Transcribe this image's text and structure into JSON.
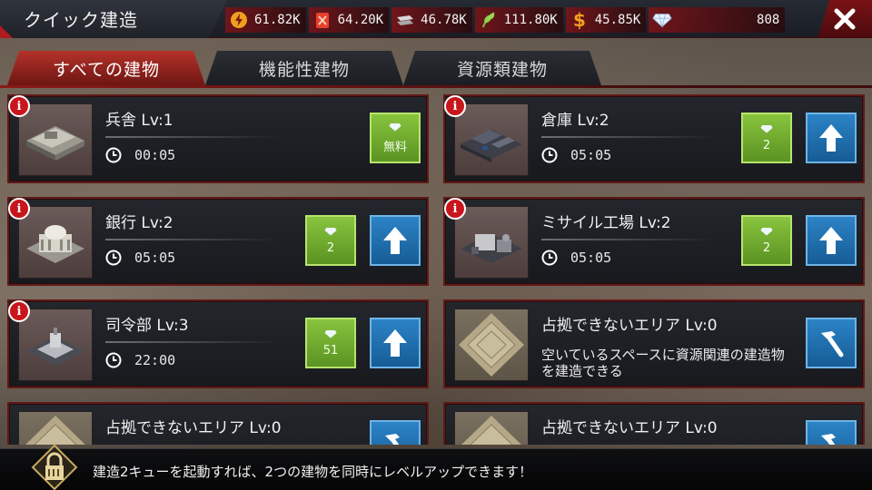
{
  "header": {
    "title": "クイック建造",
    "resources": [
      {
        "icon": "energy-icon",
        "value": "61.82K"
      },
      {
        "icon": "fuel-icon",
        "value": "64.20K"
      },
      {
        "icon": "steel-icon",
        "value": "46.78K"
      },
      {
        "icon": "food-icon",
        "value": "111.80K"
      },
      {
        "icon": "money-icon",
        "value": "45.85K"
      },
      {
        "icon": "diamond-icon",
        "value": "808"
      }
    ]
  },
  "tabs": [
    {
      "label": "すべての建物",
      "active": true
    },
    {
      "label": "機能性建物",
      "active": false
    },
    {
      "label": "資源類建物",
      "active": false
    }
  ],
  "cards": [
    {
      "name": "兵舎 Lv:1",
      "time": "00:05",
      "gem_label": "無料",
      "upgrade": false
    },
    {
      "name": "倉庫 Lv:2",
      "time": "05:05",
      "gem_label": "2",
      "upgrade": true
    },
    {
      "name": "銀行 Lv:2",
      "time": "05:05",
      "gem_label": "2",
      "upgrade": true
    },
    {
      "name": "ミサイル工場 Lv:2",
      "time": "05:05",
      "gem_label": "2",
      "upgrade": true
    },
    {
      "name": "司令部 Lv:3",
      "time": "22:00",
      "gem_label": "51",
      "upgrade": true
    },
    {
      "name": "占拠できないエリア Lv:0",
      "desc": "空いているスペースに資源関連の建造物を建造できる"
    },
    {
      "name": "占拠できないエリア Lv:0"
    },
    {
      "name": "占拠できないエリア Lv:0"
    }
  ],
  "footer": {
    "message": "建造2キューを起動すれば、2つの建物を同時にレベルアップできます！"
  },
  "colors": {
    "accent_red": "#b4322a",
    "gem_green": "#7ab436",
    "upgrade_blue": "#2472b3"
  }
}
